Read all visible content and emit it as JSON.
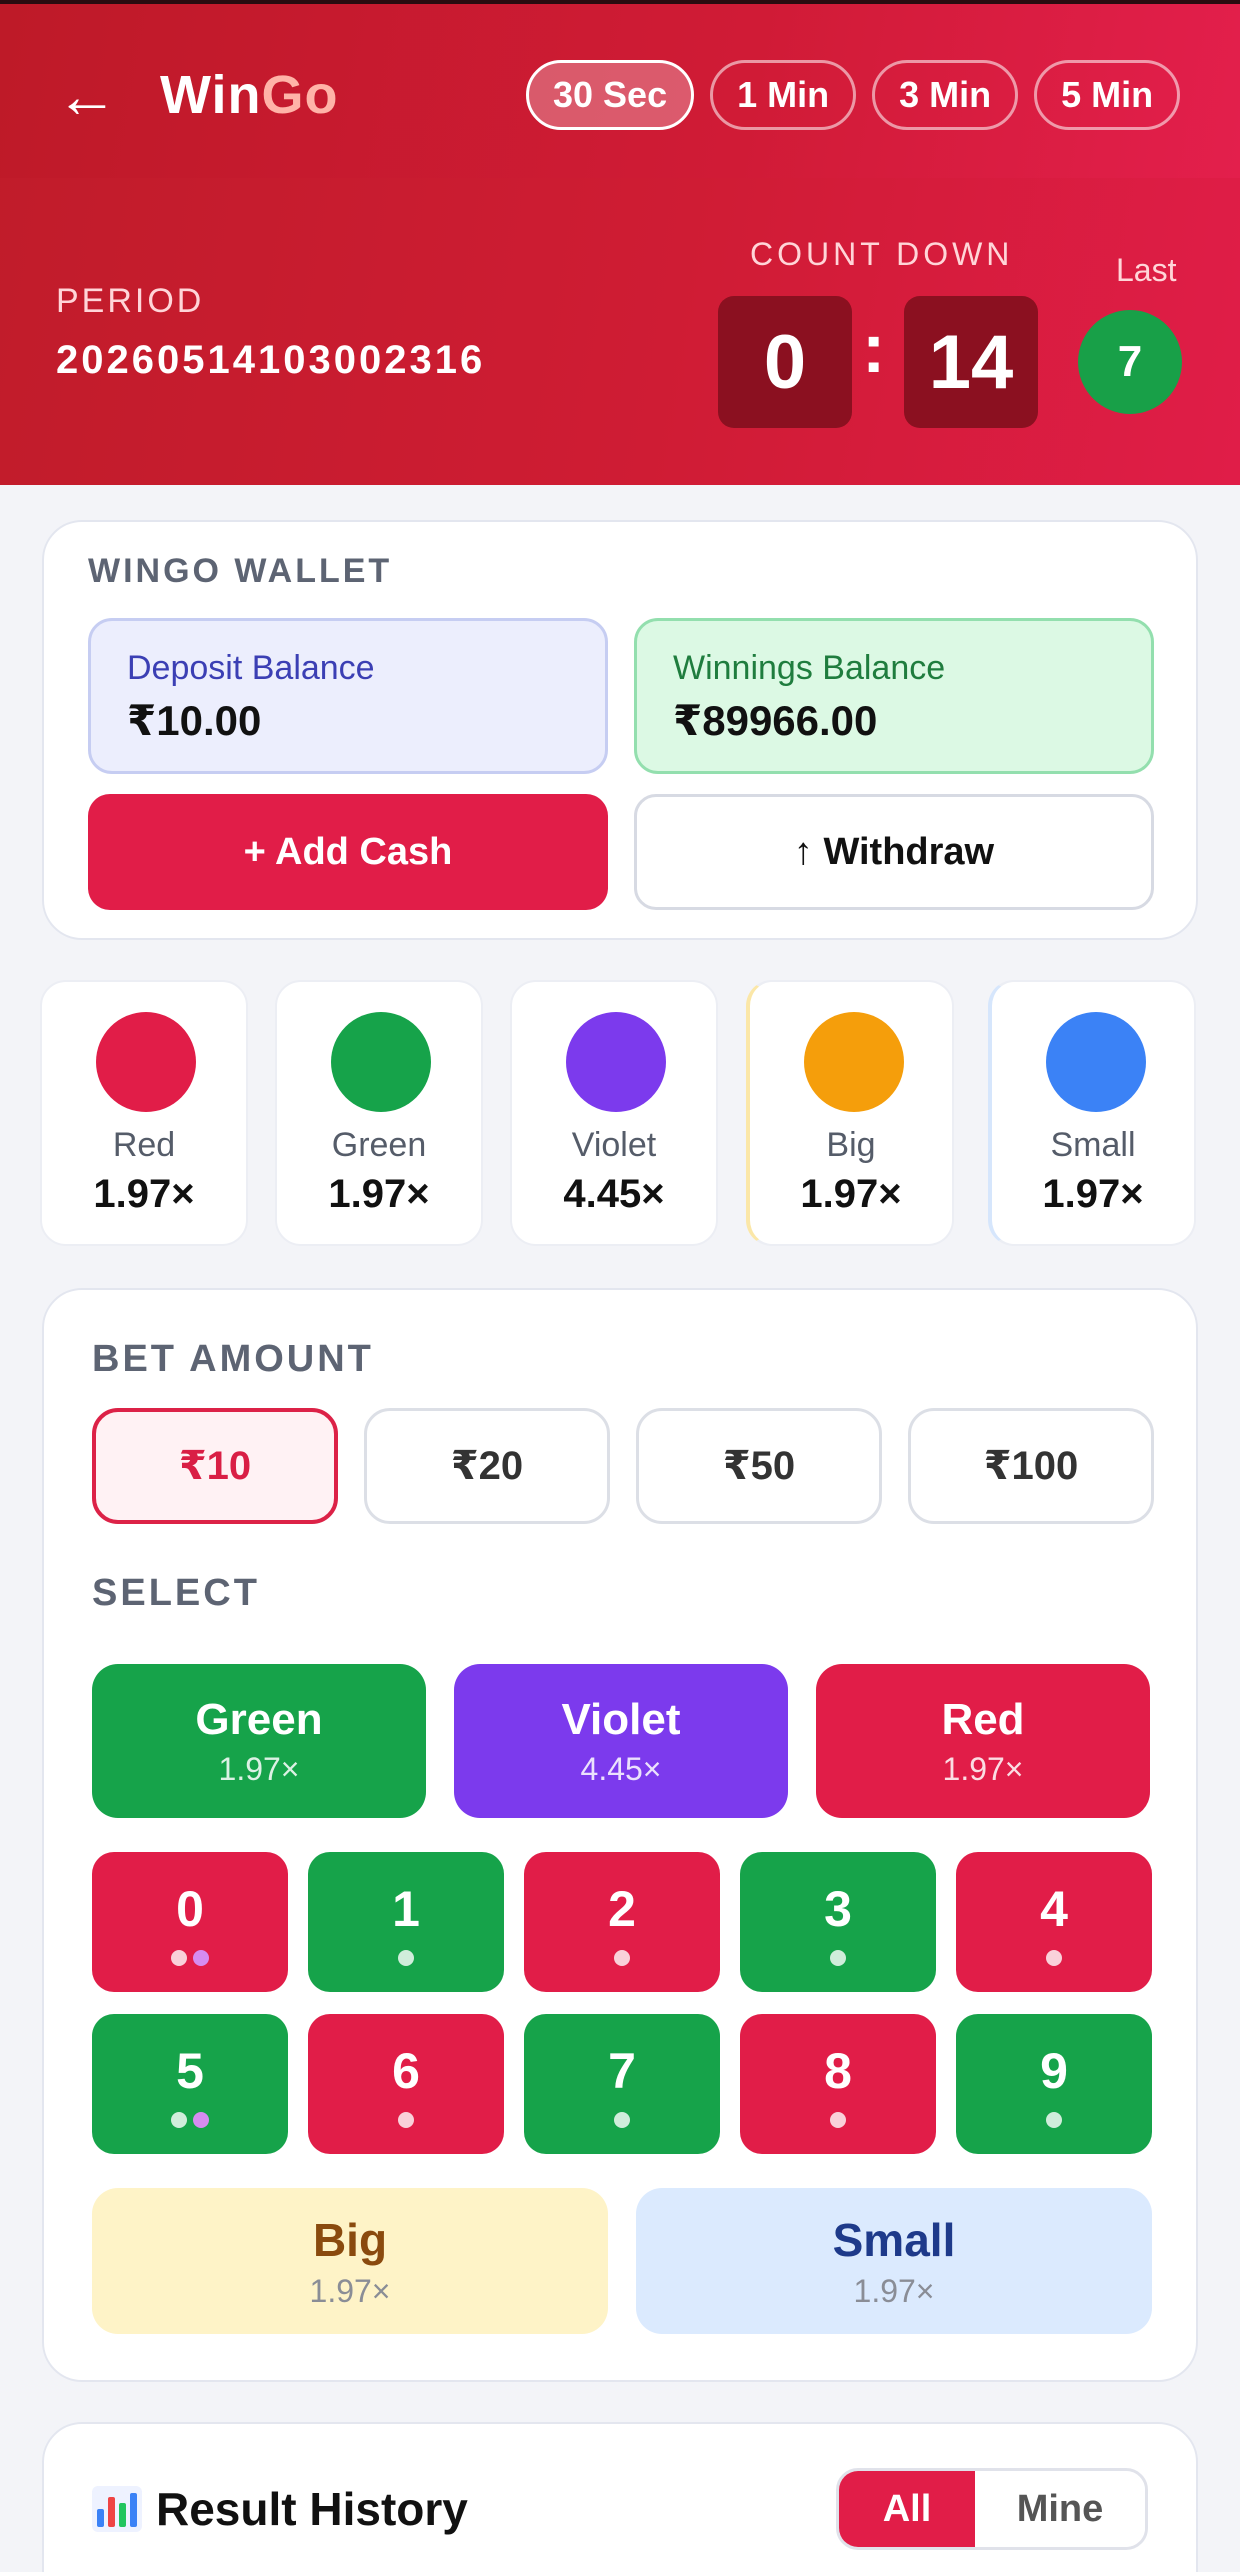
{
  "header": {
    "brand_part1": "Win",
    "brand_part2": "Go",
    "intervals": [
      "30 Sec",
      "1 Min",
      "3 Min",
      "5 Min"
    ],
    "active_interval": "30 Sec",
    "period_label": "PERIOD",
    "period_value": "20260514103002316",
    "countdown_label": "COUNT DOWN",
    "countdown_minutes": "0",
    "countdown_seconds": "14",
    "last_label": "Last",
    "last_result": "7"
  },
  "wallet": {
    "title": "WINGO WALLET",
    "deposit_label": "Deposit Balance",
    "deposit_amount": "₹10.00",
    "winnings_label": "Winnings Balance",
    "winnings_amount": "₹89966.00",
    "add_cash_label": "+ Add Cash",
    "withdraw_label": "↑ Withdraw"
  },
  "odds": [
    {
      "name": "Red",
      "mult": "1.97×",
      "color": "#e11d48"
    },
    {
      "name": "Green",
      "mult": "1.97×",
      "color": "#16a34a"
    },
    {
      "name": "Violet",
      "mult": "4.45×",
      "color": "#7c3aed"
    },
    {
      "name": "Big",
      "mult": "1.97×",
      "color": "#f59e0b"
    },
    {
      "name": "Small",
      "mult": "1.97×",
      "color": "#3b82f6"
    }
  ],
  "bet": {
    "amount_title": "BET AMOUNT",
    "amounts": [
      "₹10",
      "₹20",
      "₹50",
      "₹100"
    ],
    "selected_amount": "₹10",
    "select_title": "SELECT",
    "colors": [
      {
        "name": "Green",
        "mult": "1.97×",
        "color": "#16a34a"
      },
      {
        "name": "Violet",
        "mult": "4.45×",
        "color": "#7c3aed"
      },
      {
        "name": "Red",
        "mult": "1.97×",
        "color": "#e11d48"
      }
    ],
    "numbers": [
      "0",
      "1",
      "2",
      "3",
      "4",
      "5",
      "6",
      "7",
      "8",
      "9"
    ],
    "big": {
      "name": "Big",
      "mult": "1.97×"
    },
    "small": {
      "name": "Small",
      "mult": "1.97×"
    }
  },
  "history": {
    "title": "Result History",
    "filter_all": "All",
    "filter_mine": "Mine"
  },
  "colors": {
    "red": "#e11d48",
    "green": "#16a34a",
    "violet": "#7c3aed",
    "dot_violet": "#d68cf0"
  },
  "icons": [
    "back-arrow-icon",
    "bar-chart-icon"
  ]
}
